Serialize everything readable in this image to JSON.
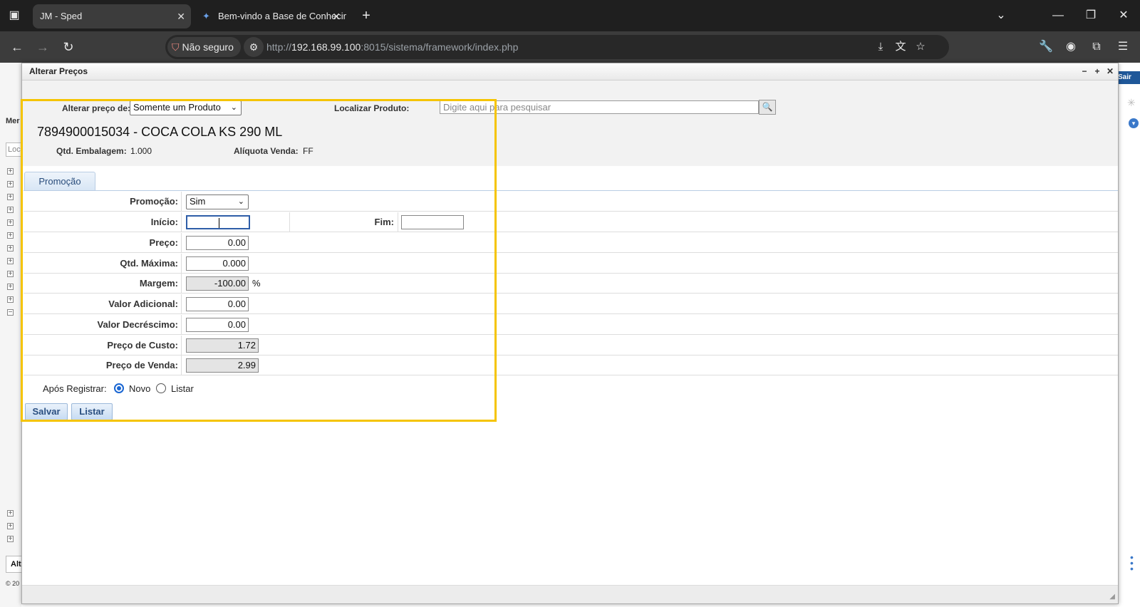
{
  "browser": {
    "tabs": [
      {
        "title": "JM - Sped",
        "active": true
      },
      {
        "title": "Bem-vindo a Base de Conhecim",
        "active": false
      }
    ],
    "security_label": "Não seguro",
    "url_prefix": "http://",
    "url_host": "192.168.99.100",
    "url_rest": ":8015/sistema/framework/index.php"
  },
  "background": {
    "sair_label": "Sair",
    "menu_label": "Mer",
    "search_placeholder": "Loc",
    "bottom_label": "Alt",
    "copyright": "© 20"
  },
  "dialog": {
    "title": "Alterar Preços",
    "alterar_label": "Alterar preço de:",
    "alterar_value": "Somente um Produto",
    "localizar_label": "Localizar Produto:",
    "localizar_placeholder": "Digite aqui para pesquisar",
    "product_title": "7894900015034 - COCA COLA  KS 290 ML",
    "qtd_embalagem_label": "Qtd. Embalagem:",
    "qtd_embalagem_value": "1.000",
    "aliquota_label": "Alíquota Venda:",
    "aliquota_value": "FF",
    "tab_label": "Promoção",
    "form": {
      "promocao_label": "Promoção:",
      "promocao_value": "Sim",
      "inicio_label": "Início:",
      "inicio_value": "",
      "fim_label": "Fim:",
      "fim_value": "",
      "preco_label": "Preço:",
      "preco_value": "0.00",
      "qtd_maxima_label": "Qtd. Máxima:",
      "qtd_maxima_value": "0.000",
      "margem_label": "Margem:",
      "margem_value": "-100.00",
      "margem_unit": "%",
      "valor_adicional_label": "Valor Adicional:",
      "valor_adicional_value": "0.00",
      "valor_decrescimo_label": "Valor Decréscimo:",
      "valor_decrescimo_value": "0.00",
      "preco_custo_label": "Preço de Custo:",
      "preco_custo_value": "1.72",
      "preco_venda_label": "Preço de Venda:",
      "preco_venda_value": "2.99"
    },
    "apos_registrar_label": "Após Registrar:",
    "radio_novo": "Novo",
    "radio_listar": "Listar",
    "salvar_label": "Salvar",
    "listar_label": "Listar"
  }
}
